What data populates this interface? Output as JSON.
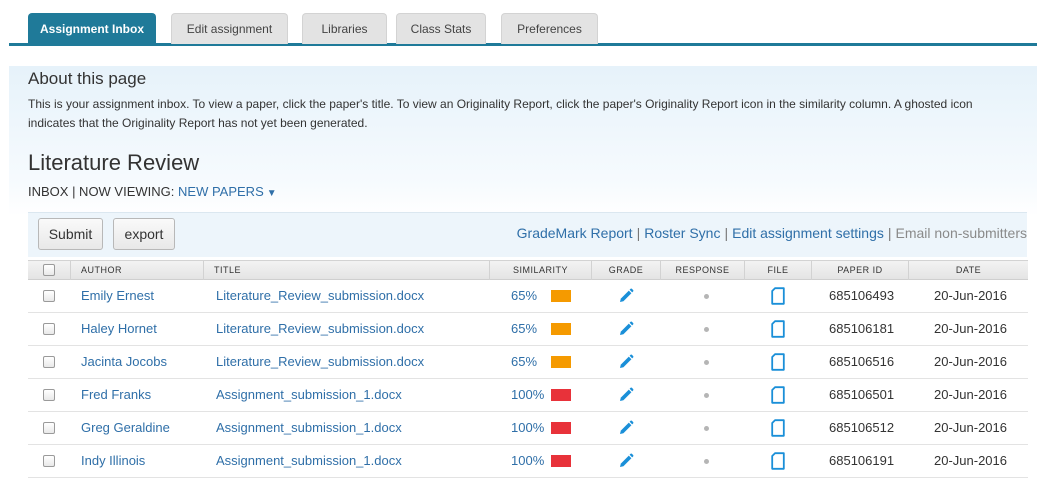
{
  "tabs": [
    {
      "label": "Assignment Inbox",
      "active": true
    },
    {
      "label": "Edit assignment",
      "active": false
    },
    {
      "label": "Libraries",
      "active": false
    },
    {
      "label": "Class Stats",
      "active": false
    },
    {
      "label": "Preferences",
      "active": false
    }
  ],
  "about": {
    "title": "About this page",
    "text": "This is your assignment inbox. To view a paper, click the paper's title. To view an Originality Report, click the paper's Originality Report icon in the similarity column. A ghosted icon indicates that the Originality Report has not yet been generated."
  },
  "assignment": {
    "title": "Literature Review",
    "inbox_prefix": "INBOX | NOW VIEWING:",
    "viewing": "NEW PAPERS",
    "caret": "▼"
  },
  "toolbar": {
    "submit_label": "Submit",
    "export_label": "export",
    "separator": "|",
    "links": [
      {
        "label": "GradeMark Report",
        "muted": false
      },
      {
        "label": "Roster Sync",
        "muted": false
      },
      {
        "label": "Edit assignment settings",
        "muted": false
      },
      {
        "label": "Email non-submitters",
        "muted": true
      }
    ]
  },
  "columns": {
    "author": "AUTHOR",
    "title": "TITLE",
    "similarity": "SIMILARITY",
    "grade": "GRADE",
    "response": "RESPONSE",
    "file": "FILE",
    "paper_id": "PAPER ID",
    "date": "DATE"
  },
  "colors": {
    "accent": "#1f7a99",
    "link": "#2f6fa8",
    "similarity_medium": "#f59a00",
    "similarity_high": "#e8323a",
    "icon": "#1a8fd8"
  },
  "icons": {
    "grade": "pencil-icon",
    "response": "dot-icon",
    "file": "document-icon"
  },
  "rows": [
    {
      "author": "Emily Ernest",
      "title": "Literature_Review_submission.docx",
      "similarity": "65%",
      "similarity_level": "medium",
      "paper_id": "685106493",
      "date": "20-Jun-2016"
    },
    {
      "author": "Haley Hornet",
      "title": "Literature_Review_submission.docx",
      "similarity": "65%",
      "similarity_level": "medium",
      "paper_id": "685106181",
      "date": "20-Jun-2016"
    },
    {
      "author": "Jacinta Jocobs",
      "title": "Literature_Review_submission.docx",
      "similarity": "65%",
      "similarity_level": "medium",
      "paper_id": "685106516",
      "date": "20-Jun-2016"
    },
    {
      "author": "Fred Franks",
      "title": "Assignment_submission_1.docx",
      "similarity": "100%",
      "similarity_level": "high",
      "paper_id": "685106501",
      "date": "20-Jun-2016"
    },
    {
      "author": "Greg Geraldine",
      "title": "Assignment_submission_1.docx",
      "similarity": "100%",
      "similarity_level": "high",
      "paper_id": "685106512",
      "date": "20-Jun-2016"
    },
    {
      "author": "Indy Illinois",
      "title": "Assignment_submission_1.docx",
      "similarity": "100%",
      "similarity_level": "high",
      "paper_id": "685106191",
      "date": "20-Jun-2016"
    }
  ]
}
